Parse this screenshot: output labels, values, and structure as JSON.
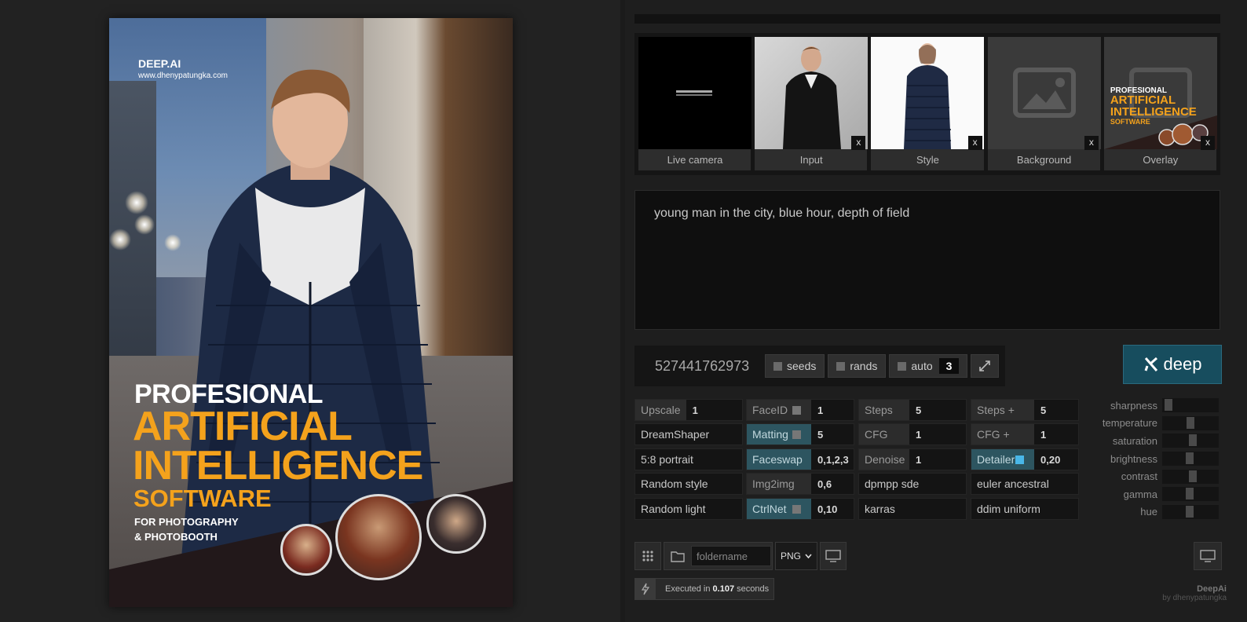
{
  "poster": {
    "brand": "DEEP.AI",
    "site": "www.dhenypatungka.com",
    "line1": "PROFESIONAL",
    "line2": "ARTIFICIAL",
    "line3": "INTELLIGENCE",
    "line4": "SOFTWARE",
    "line5": "FOR PHOTOGRAPHY",
    "line6": "& PHOTOBOOTH"
  },
  "thumbnails": [
    {
      "label": "Live camera"
    },
    {
      "label": "Input",
      "close": "x"
    },
    {
      "label": "Style",
      "close": "x"
    },
    {
      "label": "Background",
      "close": "x"
    },
    {
      "label": "Overlay",
      "close": "x"
    }
  ],
  "overlay_mini": {
    "l1": "PROFESIONAL",
    "l2": "ARTIFICIAL",
    "l3": "INTELLIGENCE",
    "l4": "SOFTWARE"
  },
  "prompt": "young man in the city, blue hour, depth of field",
  "seed": {
    "value": "527441762973",
    "seeds_label": "seeds",
    "rands_label": "rands",
    "auto_label": "auto",
    "auto_value": "3"
  },
  "deep_button": "deep",
  "grid": {
    "upscale": {
      "k": "Upscale",
      "v": "1"
    },
    "faceid": {
      "k": "FaceID",
      "v": "1"
    },
    "steps": {
      "k": "Steps",
      "v": "5"
    },
    "stepsplus": {
      "k": "Steps +",
      "v": "5"
    },
    "model": "DreamShaper",
    "matting": {
      "k": "Matting",
      "v": "5"
    },
    "cfg": {
      "k": "CFG",
      "v": "1"
    },
    "cfgplus": {
      "k": "CFG +",
      "v": "1"
    },
    "ratio": "5:8 portrait",
    "faceswap": {
      "k": "Faceswap",
      "v": "0,1,2,3"
    },
    "denoise": {
      "k": "Denoise",
      "v": "1"
    },
    "detailer": {
      "k": "Detailer",
      "v": "0,20"
    },
    "style": "Random style",
    "img2img": {
      "k": "Img2img",
      "v": "0,6"
    },
    "sampler1": "dpmpp sde",
    "sampler2": "euler ancestral",
    "light": "Random light",
    "ctrlnet": {
      "k": "CtrlNet",
      "v": "0,10"
    },
    "scheduler1": "karras",
    "scheduler2": "ddim uniform"
  },
  "sliders": [
    {
      "label": "sharpness",
      "level": 0.05
    },
    {
      "label": "temperature",
      "level": 0.5
    },
    {
      "label": "saturation",
      "level": 0.55
    },
    {
      "label": "brightness",
      "level": 0.48
    },
    {
      "label": "contrast",
      "level": 0.55
    },
    {
      "label": "gamma",
      "level": 0.48
    },
    {
      "label": "hue",
      "level": 0.48
    }
  ],
  "bottom": {
    "folder_placeholder": "foldername",
    "format": "PNG"
  },
  "status": {
    "prefix": "Executed in",
    "time": "0.107",
    "suffix": "seconds"
  },
  "footer": {
    "app": "DeepAi",
    "by": "by dhenypatungka"
  },
  "colors": {
    "accent": "#49b7e8",
    "deep_button": "#174d5e",
    "poster_orange": "#f4a21c"
  }
}
